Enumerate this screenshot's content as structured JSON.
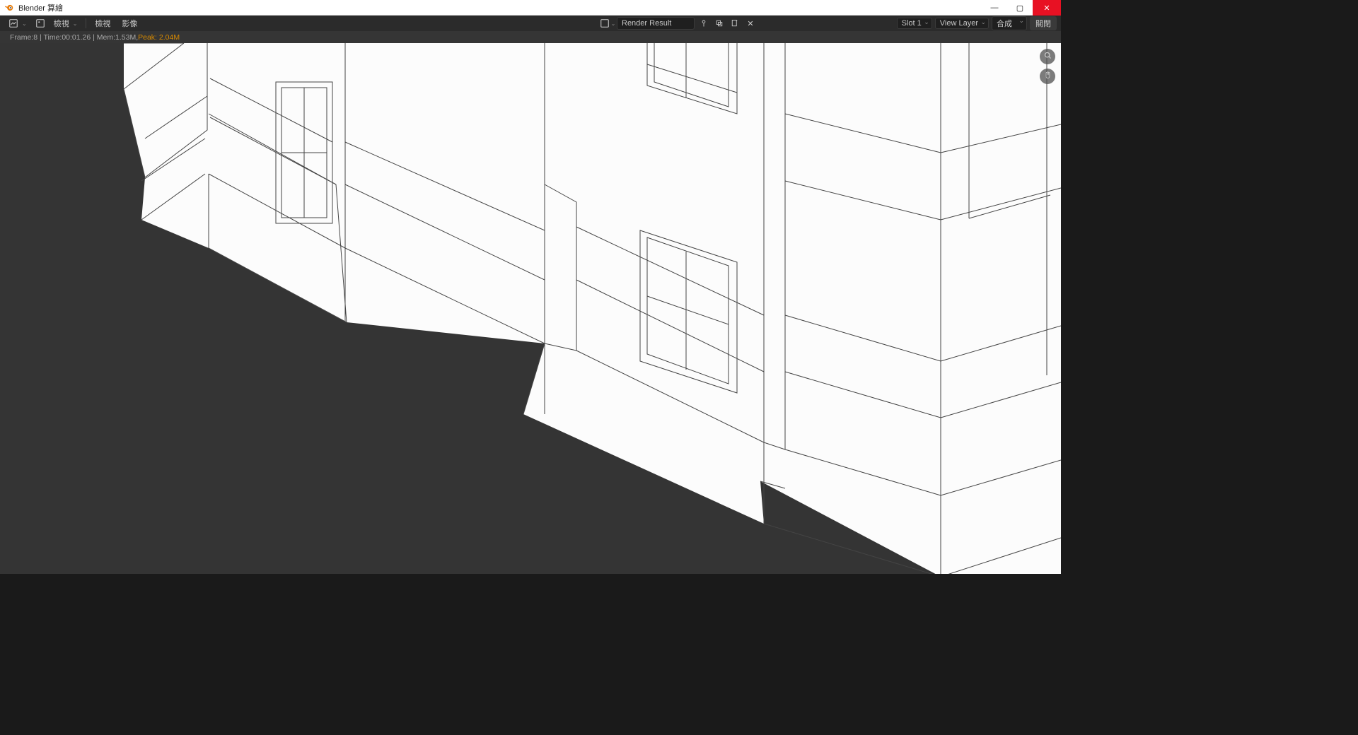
{
  "titlebar": {
    "title": "Blender 算繪",
    "minimize": "—",
    "maximize": "▢",
    "close": "✕"
  },
  "toolbar": {
    "left": {
      "editor_icon": "image-editor-icon",
      "mode_icon": "image-mode-icon",
      "view_label": "檢視",
      "view2_label": "檢視",
      "image_label": "影像"
    },
    "center": {
      "display_icon": "image-display-icon",
      "render_result": "Render Result",
      "pin_icon": "pin-icon",
      "copy_icon": "copy-icon",
      "new_icon": "new-icon",
      "close_icon": "✕"
    },
    "right": {
      "slot": "Slot 1",
      "view_layer": "View Layer",
      "composite": "合成",
      "close_btn": "關閉"
    }
  },
  "status": {
    "text_pre": "Frame:8 | Time:00:01.26 | Mem:1.53M, ",
    "text_peak": "Peak: 2.04M",
    "frame": 8,
    "time": "00:01.26",
    "mem": "1.53M",
    "peak": "2.04M"
  },
  "gizmo": {
    "zoom": "zoom-icon",
    "pan": "hand-icon"
  },
  "render": {
    "description": "Freestyle wireframe render of architectural building facade with windows, viewed at an angle on transparent background"
  }
}
